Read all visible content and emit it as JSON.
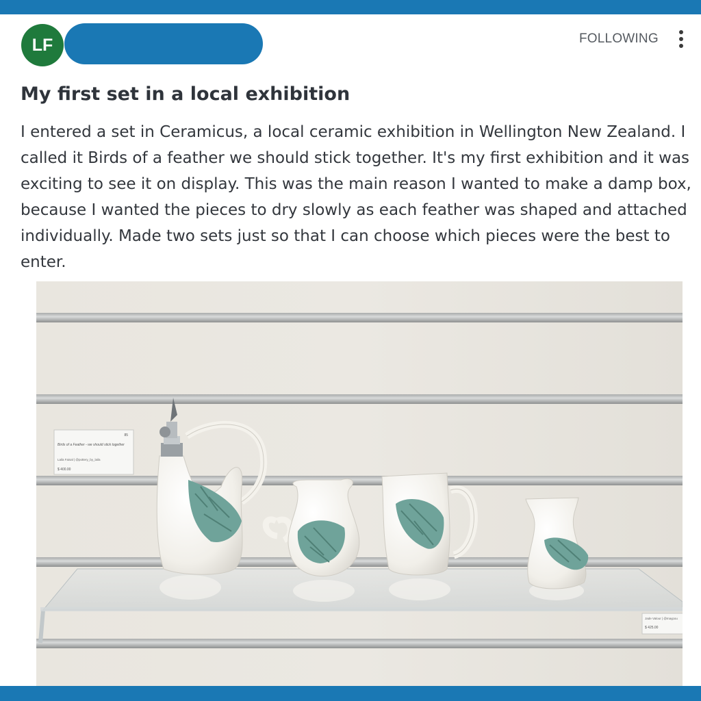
{
  "header": {
    "avatar_initials": "LF",
    "follow_label": "FOLLOWING",
    "menu_icon": "kebab-menu-icon"
  },
  "post": {
    "title": "My first set in a local exhibition",
    "body": "I entered a set in Ceramicus, a local ceramic exhibition in Wellington New Zealand. I called it Birds of a feather we should stick together. It's my first exhibition and it was exciting to see it on display. This was the main reason I wanted to make a damp box, because I wanted the pieces to dry slowly as each feather was shaped and attached individually. Made two sets just so that I can choose which pieces were the best to enter."
  },
  "photo_labels": {
    "card1_number": "85",
    "card1_title": "Birds of a Feather - we should stick together",
    "card1_artist": "Laila Faisal  |  @pottery_by_laila",
    "card1_price": "$ 400.00",
    "card2_artist": "Jade Valour  |  @maypou",
    "card2_price": "$ 425.00"
  },
  "colors": {
    "brand_bar": "#1a78b4",
    "avatar_bg": "#1f7a3c",
    "glaze": "#6fa39a"
  }
}
